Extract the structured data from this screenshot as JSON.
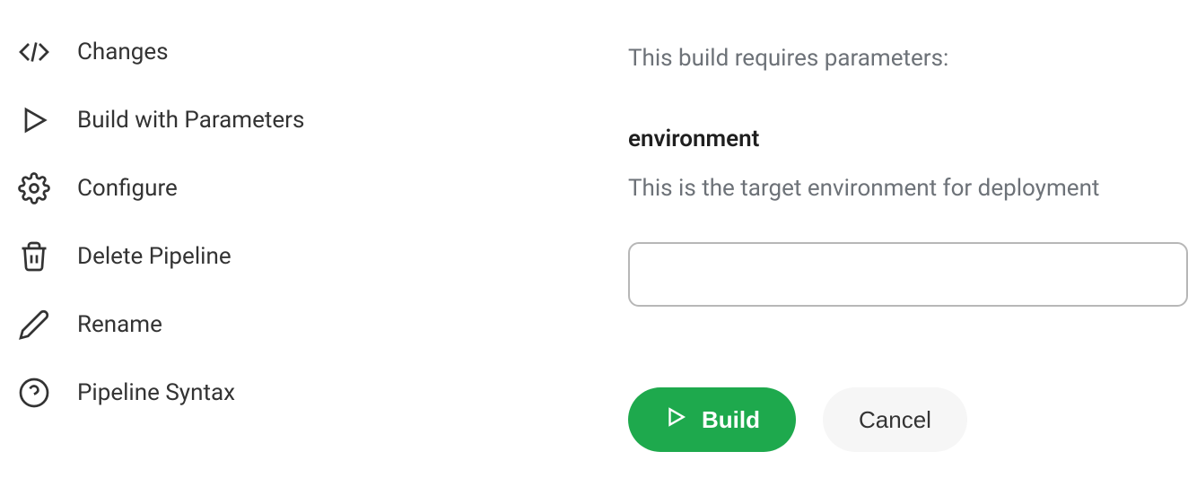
{
  "sidebar": {
    "items": [
      {
        "label": "Changes",
        "icon": "code-icon"
      },
      {
        "label": "Build with Parameters",
        "icon": "play-icon"
      },
      {
        "label": "Configure",
        "icon": "gear-icon"
      },
      {
        "label": "Delete Pipeline",
        "icon": "trash-icon"
      },
      {
        "label": "Rename",
        "icon": "pencil-icon"
      },
      {
        "label": "Pipeline Syntax",
        "icon": "help-icon"
      }
    ]
  },
  "main": {
    "intro": "This build requires parameters:",
    "param": {
      "name": "environment",
      "description": "This is the target environment for deployment",
      "value": ""
    },
    "buttons": {
      "build": "Build",
      "cancel": "Cancel"
    }
  },
  "colors": {
    "primary_green": "#1ea94d",
    "text_muted": "#6d7278",
    "text_dark": "#333333",
    "border": "#b7b7b7"
  }
}
